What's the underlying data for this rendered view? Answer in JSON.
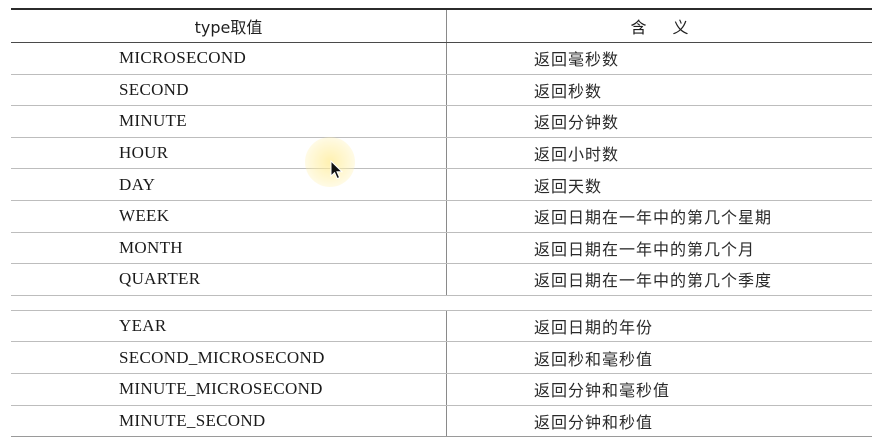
{
  "table": {
    "headers": {
      "type": "type取值",
      "meaning": "含义"
    },
    "rows": [
      {
        "type": "MICROSECOND",
        "meaning": "返回毫秒数"
      },
      {
        "type": "SECOND",
        "meaning": "返回秒数"
      },
      {
        "type": "MINUTE",
        "meaning": "返回分钟数"
      },
      {
        "type": "HOUR",
        "meaning": "返回小时数"
      },
      {
        "type": "DAY",
        "meaning": "返回天数"
      },
      {
        "type": "WEEK",
        "meaning": "返回日期在一年中的第几个星期"
      },
      {
        "type": "MONTH",
        "meaning": "返回日期在一年中的第几个月"
      },
      {
        "type": "QUARTER",
        "meaning": "返回日期在一年中的第几个季度"
      },
      {
        "type": "YEAR",
        "meaning": "返回日期的年份"
      },
      {
        "type": "SECOND_MICROSECOND",
        "meaning": "返回秒和毫秒值"
      },
      {
        "type": "MINUTE_MICROSECOND",
        "meaning": "返回分钟和毫秒值"
      },
      {
        "type": "MINUTE_SECOND",
        "meaning": "返回分钟和秒值"
      }
    ]
  },
  "cursor": {
    "icon": "mouse-pointer-icon",
    "highlight_color": "#fff0a8"
  }
}
